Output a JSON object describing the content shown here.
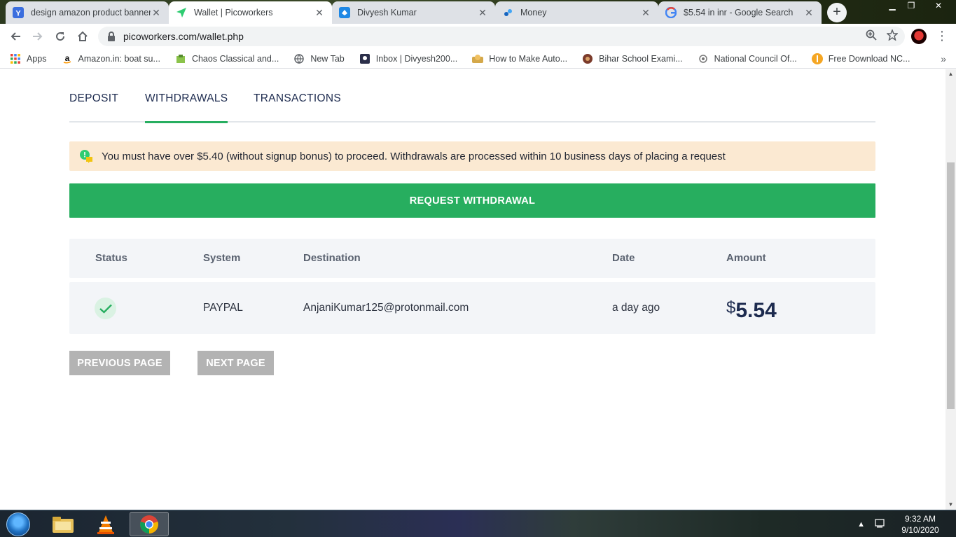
{
  "browser": {
    "tabs": [
      {
        "title": "design amazon product banner",
        "icon": "yandex-icon",
        "active": false
      },
      {
        "title": "Wallet | Picoworkers",
        "icon": "picoworkers-icon",
        "active": true
      },
      {
        "title": "Divyesh Kumar",
        "icon": "site-icon",
        "active": false
      },
      {
        "title": "Money",
        "icon": "money-icon",
        "active": false
      },
      {
        "title": "$5.54 in inr - Google Search",
        "icon": "google-icon",
        "active": false
      }
    ],
    "url": "picoworkers.com/wallet.php",
    "bookmarks": [
      {
        "label": "Apps",
        "icon": "apps-grid-icon"
      },
      {
        "label": "Amazon.in: boat su...",
        "icon": "amazon-icon"
      },
      {
        "label": "Chaos Classical and...",
        "icon": "chaos-icon"
      },
      {
        "label": "New Tab",
        "icon": "globe-icon"
      },
      {
        "label": "Inbox | Divyesh200...",
        "icon": "inbox-icon"
      },
      {
        "label": "How to Make Auto...",
        "icon": "video-icon"
      },
      {
        "label": "Bihar School Exami...",
        "icon": "bseb-icon"
      },
      {
        "label": "National Council Of...",
        "icon": "ncert-icon"
      },
      {
        "label": "Free Download NC...",
        "icon": "download-icon"
      }
    ]
  },
  "wallet": {
    "tabs": [
      "DEPOSIT",
      "WITHDRAWALS",
      "TRANSACTIONS"
    ],
    "active_tab": "WITHDRAWALS",
    "notice": "You must have over $5.40 (without signup bonus) to proceed. Withdrawals are processed within 10 business days of placing a request",
    "request_button": "REQUEST WITHDRAWAL",
    "table": {
      "headers": [
        "Status",
        "System",
        "Destination",
        "Date",
        "Amount"
      ],
      "rows": [
        {
          "status": "completed",
          "system": "PAYPAL",
          "destination": "AnjaniKumar125@protonmail.com",
          "date": "a day ago",
          "currency": "$",
          "amount": "5.54"
        }
      ]
    },
    "prev_button": "PREVIOUS PAGE",
    "next_button": "NEXT PAGE"
  },
  "taskbar": {
    "time": "9:32 AM",
    "date": "9/10/2020"
  },
  "colors": {
    "accent_green": "#27ae5f",
    "notice_bg": "#fbe9d2",
    "navy_text": "#1d2b4f",
    "pager_grey": "#b3b3b3"
  }
}
